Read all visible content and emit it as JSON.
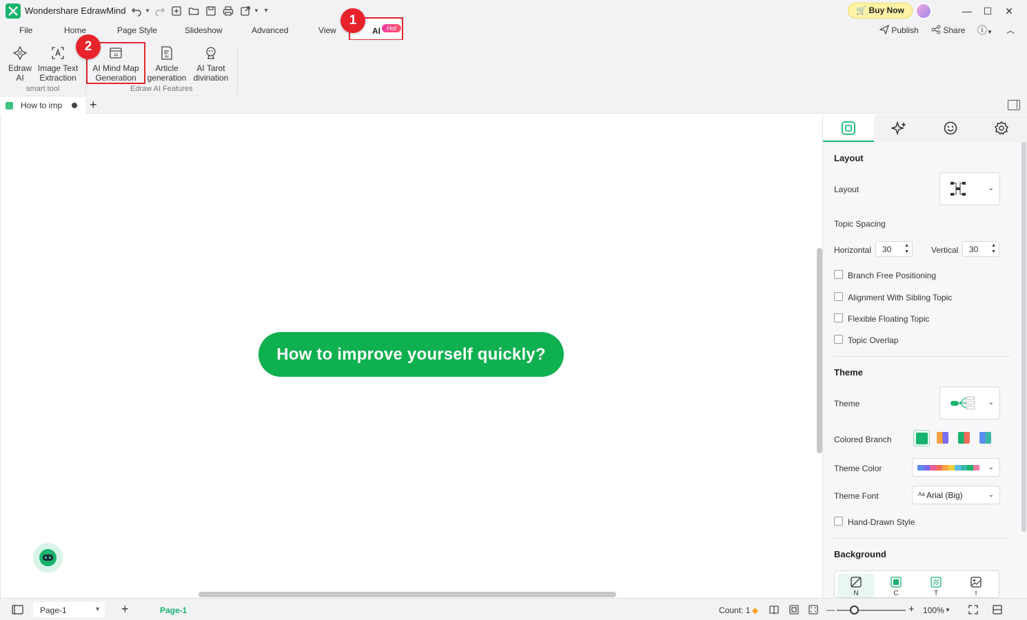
{
  "window": {
    "app_title": "Wondershare EdrawMind",
    "buy_now": "Buy Now",
    "minimize": "—",
    "maximize": "☐",
    "close": "✕"
  },
  "menu": {
    "items": [
      "File",
      "Home",
      "Page Style",
      "Slideshow",
      "Advanced",
      "View"
    ],
    "ai_tab": "AI",
    "hot_badge": "Hot",
    "publish": "Publish",
    "share": "Share"
  },
  "markers": {
    "one": "1",
    "two": "2"
  },
  "ribbon": {
    "buttons": [
      {
        "label1": "Edraw",
        "label2": "AI"
      },
      {
        "label1": "Image Text",
        "label2": "Extraction"
      },
      {
        "label1": "AI Mind Map",
        "label2": "Generation"
      },
      {
        "label1": "Article",
        "label2": "generation"
      },
      {
        "label1": "AI Tarot",
        "label2": "divination"
      }
    ],
    "groups": [
      "smart tool",
      "Edraw AI Features"
    ]
  },
  "doc_tab": {
    "name": "How to imp",
    "add": "+"
  },
  "canvas": {
    "central_topic": "How to improve yourself quickly?"
  },
  "panel": {
    "layout_section": "Layout",
    "layout_label": "Layout",
    "topic_spacing": "Topic Spacing",
    "horizontal_label": "Horizontal",
    "horizontal_value": "30",
    "vertical_label": "Vertical",
    "vertical_value": "30",
    "checkboxes": [
      "Branch Free Positioning",
      "Alignment With Sibling Topic",
      "Flexible Floating Topic",
      "Topic Overlap"
    ],
    "theme_section": "Theme",
    "theme_label": "Theme",
    "colored_branch": "Colored Branch",
    "theme_color": "Theme Color",
    "theme_font": "Theme Font",
    "theme_font_value": "Arial (Big)",
    "theme_font_prefix": "Aa",
    "hand_drawn": "Hand-Drawn Style",
    "background_section": "Background",
    "bg_items": [
      "N",
      "C",
      "T",
      "I"
    ],
    "theme_colors": [
      "#5b8def",
      "#7b6cf0",
      "#e85d9e",
      "#f26b5b",
      "#f5a340",
      "#f2d040",
      "#55c1e8",
      "#3bb4a8",
      "#18b36d",
      "#f17da0"
    ]
  },
  "status": {
    "page_select": "Page-1",
    "page_tab": "Page-1",
    "count": "Count: 1",
    "zoom": "100%",
    "zoom_minus": "—",
    "zoom_plus": "+",
    "add_page": "+"
  },
  "colors": {
    "accent": "#18b36d",
    "topic": "#0fb04f",
    "marker": "#e8222a"
  }
}
